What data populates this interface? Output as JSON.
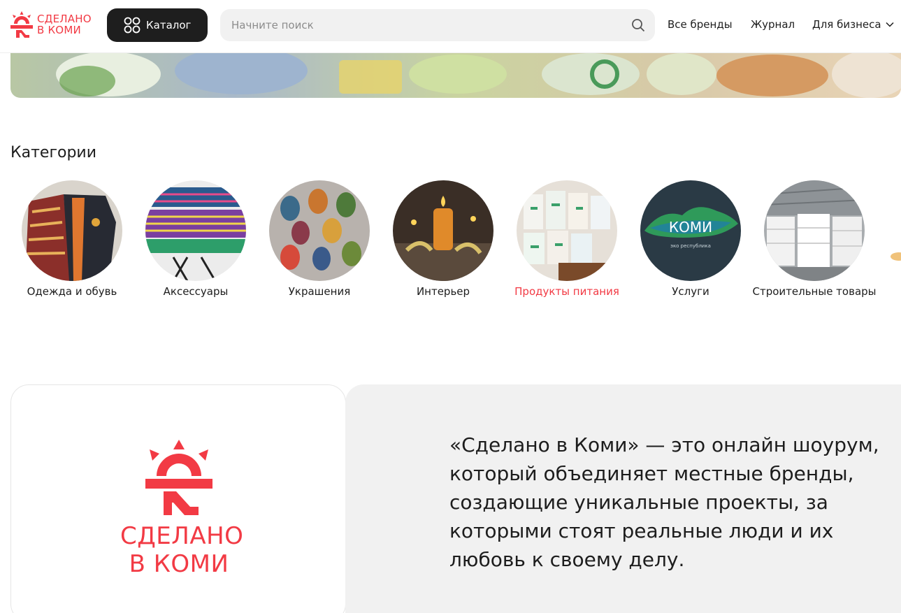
{
  "brand": {
    "line1": "СДЕЛАНО",
    "line2": "В КОМИ",
    "color": "#f23a44"
  },
  "header": {
    "catalog_label": "Каталог",
    "search_placeholder": "Начните поиск",
    "nav": {
      "brands": "Все бренды",
      "journal": "Журнал",
      "business": "Для бизнеса"
    }
  },
  "categories": {
    "title": "Категории",
    "items": [
      {
        "label": "Одежда и обувь"
      },
      {
        "label": "Аксессуары"
      },
      {
        "label": "Украшения"
      },
      {
        "label": "Интерьер"
      },
      {
        "label": "Продукты питания",
        "active": true
      },
      {
        "label": "Услуги"
      },
      {
        "label": "Строительные товары"
      }
    ],
    "services_badge": {
      "word": "КОМИ",
      "sub": "эко республика"
    }
  },
  "about": {
    "text": "«Сделано в Коми» — это онлайн шоурум, который объединяет местные бренды, создающие уникальные проекты, за которыми стоят реальные люди и их любовь к своему делу."
  },
  "colors": {
    "accent": "#f23a44",
    "dark_button": "#1e1e1e",
    "panel": "#f1f1f1"
  }
}
